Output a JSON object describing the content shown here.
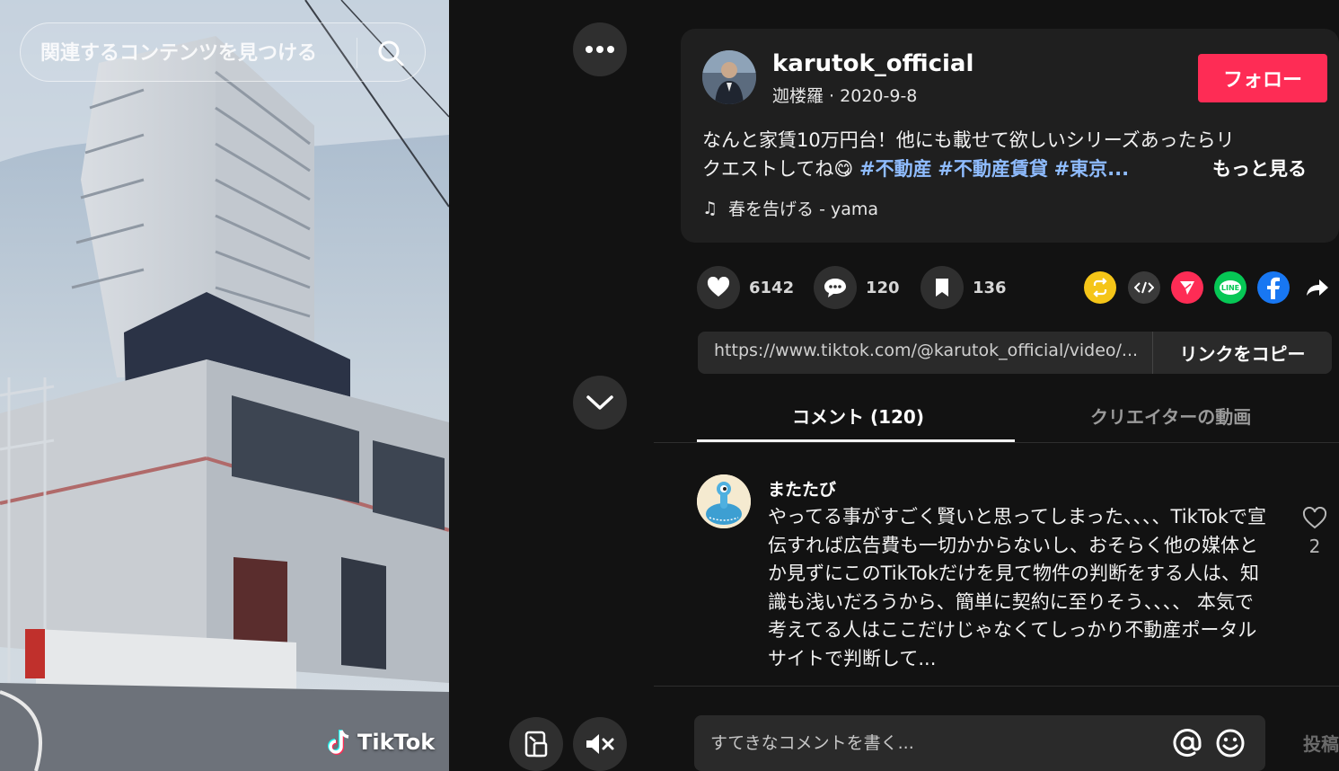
{
  "search": {
    "placeholder": "関連するコンテンツを見つける",
    "button_icon": "search-icon"
  },
  "video": {
    "watermark": "TikTok",
    "more_icon": "more-dots-icon",
    "next_icon": "chevron-down-icon",
    "mute_icon": "speaker-muted-icon",
    "device_icon": "mini-player-icon"
  },
  "post": {
    "username": "karutok_official",
    "display_name": "迦楼羅",
    "date": "2020-9-8",
    "follow_label": "フォロー",
    "description_line1": "なんと家賃10万円台！他にも載せて欲しいシリーズあったらリ",
    "description_line2_prefix": "クエストしてね",
    "emoji": "😋",
    "hashtags": [
      "#不動産",
      "#不動産賃貸",
      "#東京..."
    ],
    "more_label": "もっと見る",
    "music_icon": "♫",
    "music": "春を告げる - yama"
  },
  "actions": {
    "likes": "6142",
    "comments": "120",
    "saves": "136"
  },
  "share": {
    "icons": [
      "repost-icon",
      "embed-icon",
      "send-icon",
      "line-icon",
      "facebook-icon",
      "share-arrow-icon"
    ],
    "colors": {
      "repost": "#f5c518",
      "embed": "#3a3a3a",
      "send": "#fe2c55",
      "line": "#06c755",
      "facebook": "#1877f2"
    }
  },
  "link": {
    "url": "https://www.tiktok.com/@karutok_official/video/...",
    "copy_label": "リンクをコピー"
  },
  "tabs": {
    "comments": "コメント (120)",
    "creator_videos": "クリエイターの動画"
  },
  "comment": {
    "user": "またたび",
    "text": "やってる事がすごく賢いと思ってしまった、、、、TikTokで宣伝すれば広告費も一切かからないし、おそらく他の媒体とか見ずにこのTikTokだけを見て物件の判断をする人は、知識も浅いだろうから、簡単に契約に至りそう、、、、 本気で考えてる人はここだけじゃなくてしっかり不動産ポータルサイトで判断して...",
    "likes": "2"
  },
  "composer": {
    "placeholder": "すてきなコメントを書く...",
    "post_label": "投稿"
  },
  "colors": {
    "background": "#121212",
    "card": "#1f1f1f",
    "accent": "#fe2c55",
    "hashtag": "#8fbcff"
  }
}
